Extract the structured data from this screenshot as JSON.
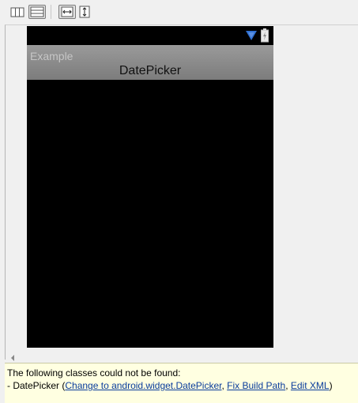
{
  "toolbar": {
    "buttons": [
      {
        "name": "split-vertical",
        "icon": "columns-layout-icon"
      },
      {
        "name": "split-horizontal",
        "icon": "rows-layout-icon",
        "active": true
      },
      {
        "name": "toggle-width",
        "icon": "horizontal-arrows-icon",
        "active": true
      },
      {
        "name": "toggle-height",
        "icon": "vertical-arrows-icon"
      }
    ]
  },
  "device": {
    "status_icons": [
      "wifi-signal-icon",
      "battery-icon"
    ],
    "app_title": "Example",
    "widget_label": "DatePicker"
  },
  "error": {
    "message": "The following classes could not be found:",
    "prefix": "- DatePicker (",
    "link_change": "Change to android.widget.DatePicker",
    "sep1": ", ",
    "link_fix": "Fix Build Path",
    "sep2": ", ",
    "link_edit": "Edit XML",
    "suffix": ")"
  },
  "colors": {
    "error_bg": "#ffffe1",
    "link": "#0a3c9c",
    "device_bg": "#000000",
    "title_bar": "#8a8a8a",
    "wifi_blue": "#2f6fd1"
  }
}
